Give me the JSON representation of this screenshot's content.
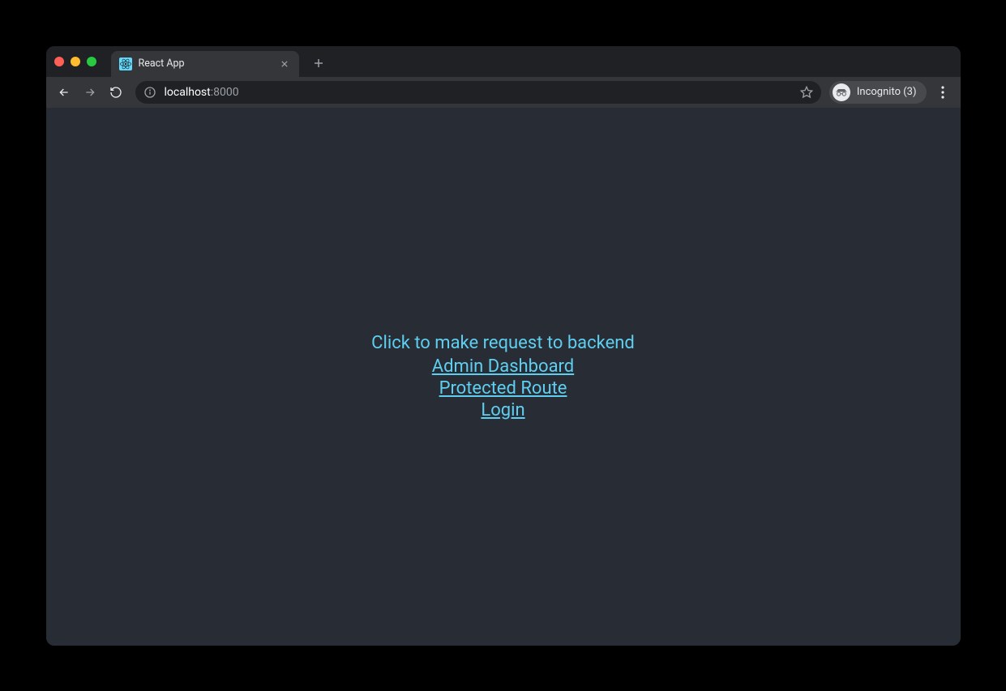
{
  "tab": {
    "title": "React App"
  },
  "address": {
    "host": "localhost",
    "port": ":8000"
  },
  "incognito": {
    "label": "Incognito (3)"
  },
  "page": {
    "heading": "Click to make request to backend",
    "links": {
      "admin": "Admin Dashboard",
      "protected": "Protected Route",
      "login": "Login"
    }
  }
}
